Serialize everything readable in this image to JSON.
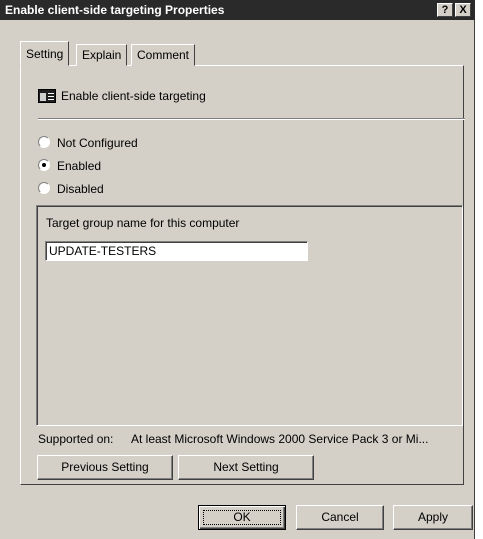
{
  "window": {
    "title": "Enable client-side targeting Properties",
    "help_button": "?",
    "close_button": "X"
  },
  "tabs": [
    {
      "label": "Setting",
      "active": true
    },
    {
      "label": "Explain",
      "active": false
    },
    {
      "label": "Comment",
      "active": false
    }
  ],
  "policy": {
    "name": "Enable client-side targeting",
    "icon": "policy-setting-icon"
  },
  "state_options": [
    {
      "label": "Not Configured",
      "checked": false
    },
    {
      "label": "Enabled",
      "checked": true
    },
    {
      "label": "Disabled",
      "checked": false
    }
  ],
  "options_group": {
    "field_label": "Target group name for this computer",
    "field_value": "UPDATE-TESTERS"
  },
  "supported_on": {
    "label": "Supported on:",
    "value": "At least Microsoft Windows 2000 Service Pack 3 or Mi..."
  },
  "nav_buttons": {
    "previous": "Previous Setting",
    "next": "Next Setting"
  },
  "dialog_buttons": {
    "ok": "OK",
    "cancel": "Cancel",
    "apply": "Apply"
  }
}
